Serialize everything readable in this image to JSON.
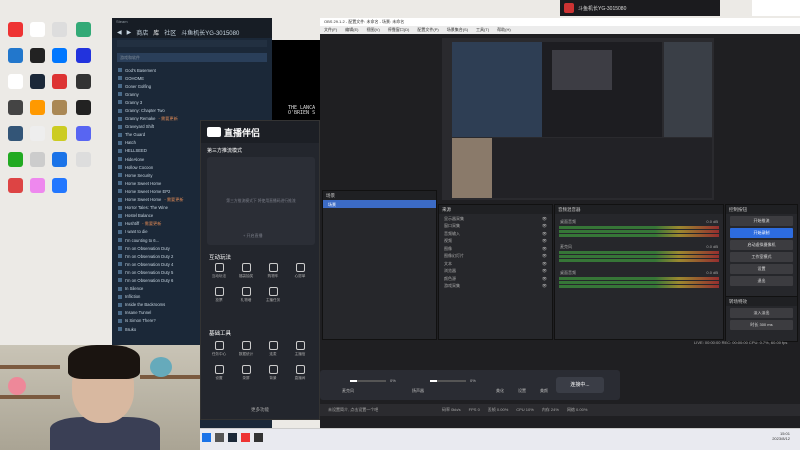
{
  "desktop": {
    "icons": [
      {
        "label": "Chrome",
        "color": "#e33"
      },
      {
        "label": "文档",
        "color": "#fff"
      },
      {
        "label": "",
        "color": "#ddd"
      },
      {
        "label": "",
        "color": "#3a7"
      },
      {
        "label": "",
        "color": "#27c"
      },
      {
        "label": "",
        "color": "#222"
      },
      {
        "label": "",
        "color": "#07f"
      },
      {
        "label": "",
        "color": "#23d"
      },
      {
        "label": "",
        "color": "#fff"
      },
      {
        "label": "",
        "color": "#1b2838"
      },
      {
        "label": "",
        "color": "#d33"
      },
      {
        "label": "",
        "color": "#333"
      },
      {
        "label": "",
        "color": "#444"
      },
      {
        "label": "",
        "color": "#f90"
      },
      {
        "label": "",
        "color": "#a85"
      },
      {
        "label": "",
        "color": "#222"
      },
      {
        "label": "",
        "color": "#357"
      },
      {
        "label": "",
        "color": "#eee"
      },
      {
        "label": "",
        "color": "#cc2"
      },
      {
        "label": "",
        "color": "#5865f2"
      },
      {
        "label": "",
        "color": "#2a2"
      },
      {
        "label": "",
        "color": "#ccc"
      },
      {
        "label": "",
        "color": "#1a73e8"
      },
      {
        "label": "",
        "color": "#ddd"
      },
      {
        "label": "",
        "color": "#d44"
      },
      {
        "label": "",
        "color": "#e8e"
      },
      {
        "label": "",
        "color": "#27f"
      }
    ]
  },
  "notif": {
    "text": "斗鱼机长YG-3015080"
  },
  "steam": {
    "window_title": "Steam",
    "nav": [
      "商店",
      "库",
      "社区",
      "斗鱼机长YG-3015080"
    ],
    "search_placeholder": "游戏和软件",
    "games": [
      {
        "name": "God's Basement"
      },
      {
        "name": "GOHOME"
      },
      {
        "name": "Goner Golfing"
      },
      {
        "name": "Granny"
      },
      {
        "name": "Granny 3"
      },
      {
        "name": "Granny: Chapter Two"
      },
      {
        "name": "Granny Remake",
        "tag": " - 需要更新"
      },
      {
        "name": "Graveyard Shift"
      },
      {
        "name": "The Guard"
      },
      {
        "name": "Hatch"
      },
      {
        "name": "HELLSEED"
      },
      {
        "name": "HideAlone"
      },
      {
        "name": "Hollow Cocoon"
      },
      {
        "name": "Home Security"
      },
      {
        "name": "Home Sweet Home"
      },
      {
        "name": "Home Sweet Home EP2"
      },
      {
        "name": "Home Sweet Home",
        "tag": " - 需要更新"
      },
      {
        "name": "Horror Tales: The Wine"
      },
      {
        "name": "Hostel Balance"
      },
      {
        "name": "Hushtiff",
        "tag": " - 需要更新"
      },
      {
        "name": "I want to die"
      },
      {
        "name": "I'm counting to 6..."
      },
      {
        "name": "I'm on Observation Duty"
      },
      {
        "name": "I'm on Observation Duty 2"
      },
      {
        "name": "I'm on Observation Duty 4"
      },
      {
        "name": "I'm on Observation Duty 5"
      },
      {
        "name": "I'm on Observation Duty 6"
      },
      {
        "name": "In Silence"
      },
      {
        "name": "Infliction"
      },
      {
        "name": "Inside the Backrooms"
      },
      {
        "name": "Insane Tunnel"
      },
      {
        "name": "Is Simon There?"
      },
      {
        "name": "Itsuko"
      }
    ]
  },
  "game": {
    "lines": [
      "THE LANCA",
      "O'BRIEN S"
    ]
  },
  "live": {
    "title": "直播伴侣",
    "mode": "第三方推流模式",
    "hint": "第三方推流模式下 将使用直播码进行推流",
    "start_btn": "+ 开启直播",
    "sec1": "互动玩法",
    "tools1": [
      "互动玩法",
      "福袋抽奖",
      "购物车",
      "心愿单",
      "投票",
      "礼物墙",
      "主播任务"
    ],
    "sec2": "基础工具",
    "tools2": [
      "任务中心",
      "数据统计",
      "连麦",
      "主播信",
      "设置",
      "录屏",
      "背景",
      "直播间"
    ],
    "more": "更多功能"
  },
  "obs": {
    "title": "OBS 29.1.2 - 配置文件: 未命名 - 场景: 未命名",
    "menu": [
      "文件(F)",
      "编辑(E)",
      "视图(V)",
      "停靠窗口(D)",
      "配置文件(P)",
      "场景集合(S)",
      "工具(T)",
      "帮助(H)"
    ],
    "scenes_header": "场景",
    "scenes": [
      "场景"
    ],
    "sources_header": "来源",
    "sources": [
      "显示器采集",
      "窗口采集",
      "音频输入",
      "视频",
      "图像",
      "图像幻灯片",
      "文本",
      "浏览器",
      "颜色源",
      "游戏采集"
    ],
    "mixer_header": "音频混音器",
    "mixer": [
      {
        "name": "桌面音频",
        "db": "0.0 dB"
      },
      {
        "name": "麦克风",
        "db": "0.0 dB"
      },
      {
        "name": "桌面音频",
        "db": "0.0 dB"
      }
    ],
    "controls_header": "控制按钮",
    "controls": [
      "开始推流",
      "开始录制",
      "启动虚拟摄像机",
      "工作室模式",
      "设置",
      "退出"
    ],
    "trans_header": "转场特效",
    "trans": [
      "淡入淡出",
      "时长 300 ms"
    ],
    "status": "LIVE: 00:00:00  REC: 00:00:00  CPU: 0.7%, 60.00 fps"
  },
  "livebar": {
    "mic": "麦克风",
    "speaker": "扬声器",
    "pct1": "0%",
    "pct2": "0%",
    "icons": [
      "美化",
      "设置",
      "美颜"
    ],
    "go": "连接中..."
  },
  "bottom": {
    "text": "未设置简介, 点击设置一个吧",
    "stats": [
      "码率 0kb/s",
      "FPS 0",
      "丢帧 0.00%",
      "CPU 10%",
      "内存 24%",
      "网络 0.00%"
    ]
  },
  "clock": {
    "time": "15:01",
    "date": "2023/8/12"
  }
}
